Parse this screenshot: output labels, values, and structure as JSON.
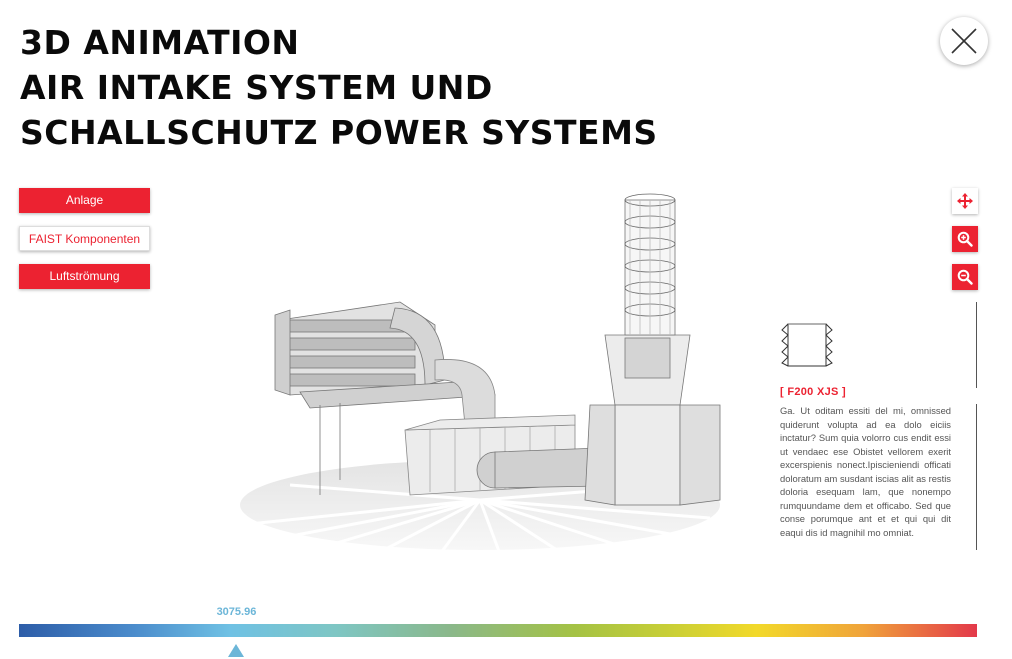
{
  "header": {
    "title_lines": [
      "3D ANIMATION",
      "AIR INTAKE SYSTEM UND",
      "SCHALLSCHUTZ POWER SYSTEMS"
    ]
  },
  "close_button": {
    "icon": "close-icon"
  },
  "mode_buttons": [
    {
      "label": "Anlage",
      "state": "active"
    },
    {
      "label": "FAIST Komponenten",
      "state": "inactive"
    },
    {
      "label": "Luftströmung",
      "state": "active"
    }
  ],
  "tools": [
    {
      "icon": "move-icon"
    },
    {
      "icon": "zoom-in-icon"
    },
    {
      "icon": "zoom-out-icon"
    }
  ],
  "info_panel": {
    "icon": "silencer-module-icon",
    "title": "[ F200 XJS ]",
    "body": "Ga. Ut oditam essiti del mi, omnissed quiderunt volupta ad ea dolo eiciis inctatur? Sum quia volorro cus endit essi ut vendaec ese Obistet vellorem exerit excerspienis nonect.Ipiscieniendi officati doloratum am susdant iscias alit as restis doloria esequam lam, que nonempo rumquundame dem et officabo. Sed que conse porumque ant et et qui qui dit eaqui dis id magnihil mo omniat."
  },
  "slider": {
    "value": "3075.96",
    "position_fraction": 0.227
  },
  "colors": {
    "accent": "#ec2231",
    "slider": "#6cb6d8"
  }
}
